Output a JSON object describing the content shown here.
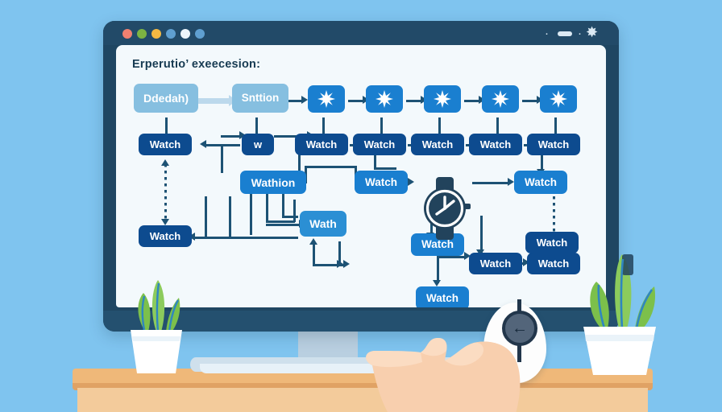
{
  "scene": {
    "background_color": "#7fc4ef",
    "desk_color": "#efb879",
    "monitor_frame_color": "#1f4662",
    "screen_color": "#f3f9fc"
  },
  "window": {
    "traffic_lights": [
      {
        "name": "close",
        "color": "#f08070"
      },
      {
        "name": "minimize",
        "color": "#7cb342"
      },
      {
        "name": "zoom",
        "color": "#f5b942"
      },
      {
        "name": "tab-blue-1",
        "color": "#5f9fd0"
      },
      {
        "name": "tab-white",
        "color": "#eef5fa"
      },
      {
        "name": "tab-blue-2",
        "color": "#5f9fd0"
      }
    ],
    "right_controls": [
      {
        "name": "dot-left",
        "glyph": "·"
      },
      {
        "name": "minimize",
        "glyph": "—"
      },
      {
        "name": "dot-right",
        "glyph": "·"
      },
      {
        "name": "settings-burst",
        "glyph": "✸"
      }
    ]
  },
  "screen": {
    "title": "Erperutio’ exeecesion:"
  },
  "diagram": {
    "colors": {
      "pale": "#86bfe0",
      "mid": "#2b8fd4",
      "blue": "#1a7fd0",
      "navy": "#0d4b8f",
      "connector": "#1d5274"
    },
    "row1": [
      {
        "label": "Ddedah)",
        "style": "pale"
      },
      {
        "label": "Snttion",
        "style": "pale"
      },
      {
        "label": "",
        "style": "blue",
        "icon": "burst-icon"
      },
      {
        "label": "",
        "style": "blue",
        "icon": "burst-icon"
      },
      {
        "label": "",
        "style": "blue",
        "icon": "burst-icon"
      },
      {
        "label": "",
        "style": "blue",
        "icon": "burst-icon"
      },
      {
        "label": "",
        "style": "blue",
        "icon": "burst-icon"
      }
    ],
    "row2": [
      {
        "label": "Watch",
        "style": "navy"
      },
      {
        "label": "w",
        "style": "navy"
      },
      {
        "label": "Watch",
        "style": "navy"
      },
      {
        "label": "Watch",
        "style": "navy"
      },
      {
        "label": "Watch",
        "style": "navy"
      },
      {
        "label": "Watch",
        "style": "navy"
      },
      {
        "label": "Watch",
        "style": "navy"
      }
    ],
    "row3": [
      {
        "label": "Wathion",
        "style": "blue"
      },
      {
        "label": "Watch",
        "style": "blue"
      },
      {
        "label": "Watch",
        "style": "blue"
      }
    ],
    "row4": [
      {
        "label": "Watch",
        "style": "navy"
      },
      {
        "label": "Wath",
        "style": "mid"
      },
      {
        "label": "Watch",
        "style": "blue"
      }
    ],
    "row5": [
      {
        "label": "Watch",
        "style": "navy"
      },
      {
        "label": "Watch",
        "style": "navy"
      },
      {
        "label": "Watch",
        "style": "navy"
      }
    ],
    "row6": [
      {
        "label": "Watch",
        "style": "blue"
      }
    ],
    "watch_icon": {
      "name": "wristwatch-icon",
      "color": "#22435c"
    }
  },
  "props": {
    "left_plant": {
      "name": "potted-plant-left",
      "leaf_color": "#7cc04b",
      "pot_color": "#ffffff"
    },
    "right_plant": {
      "name": "potted-plant-right",
      "leaf_color": "#7cc04b",
      "pot_color": "#ffffff"
    },
    "mouse": {
      "name": "computer-mouse",
      "body_color": "#fdfdfd",
      "wheel_color": "#53657a",
      "glyph": "←"
    },
    "hand": {
      "name": "human-hand",
      "skin_color": "#f6c9a8"
    }
  }
}
